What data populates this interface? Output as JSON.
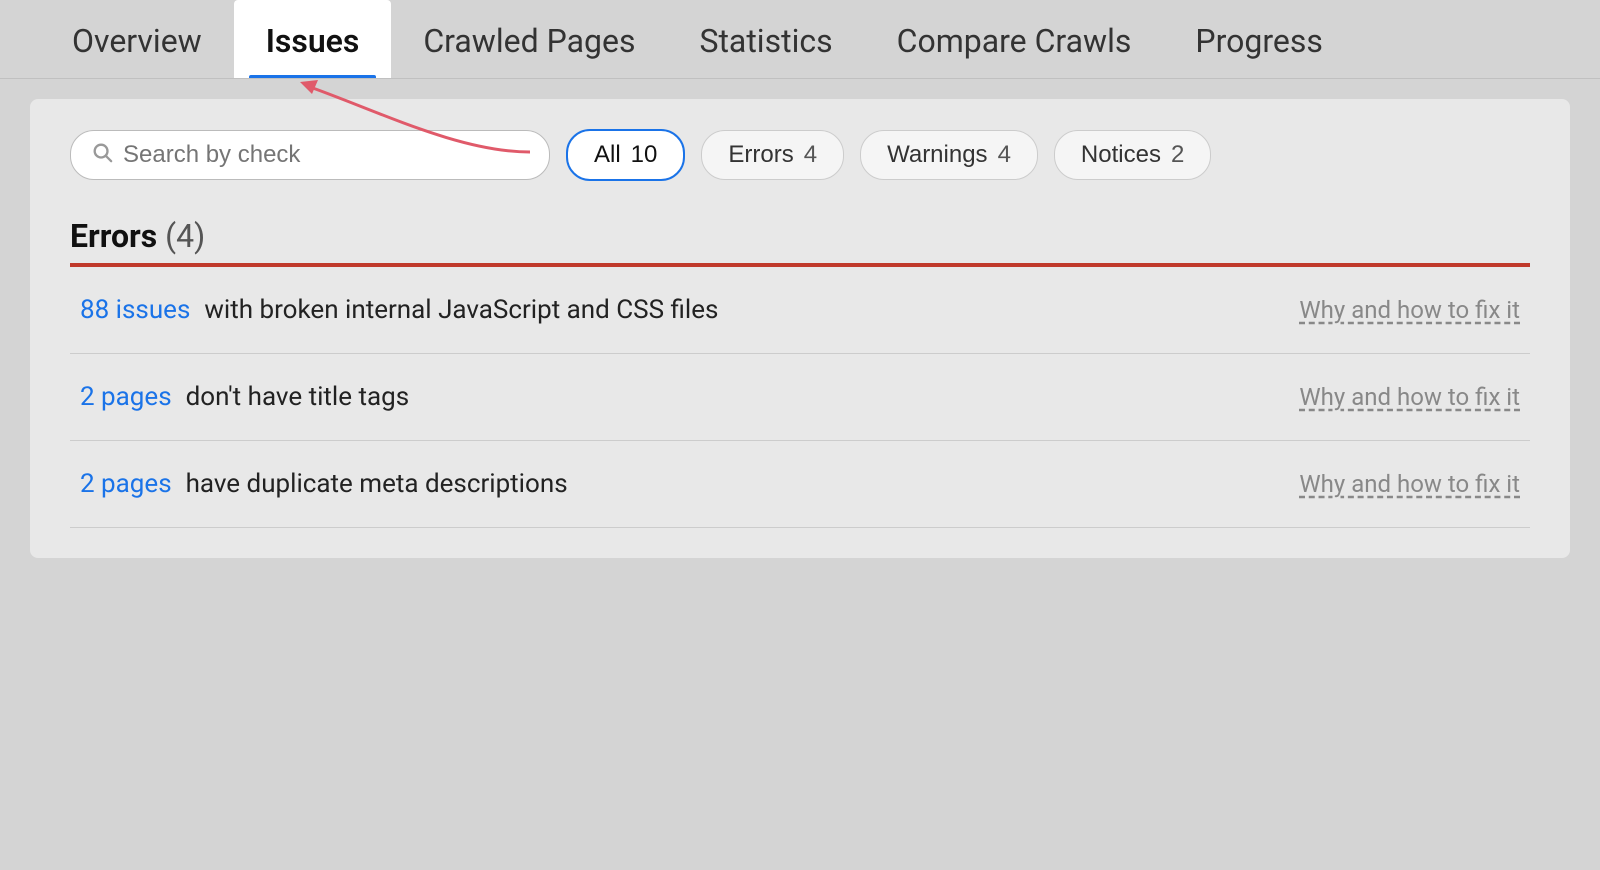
{
  "tabs": [
    {
      "id": "overview",
      "label": "Overview",
      "active": false
    },
    {
      "id": "issues",
      "label": "Issues",
      "active": true
    },
    {
      "id": "crawled-pages",
      "label": "Crawled Pages",
      "active": false
    },
    {
      "id": "statistics",
      "label": "Statistics",
      "active": false
    },
    {
      "id": "compare-crawls",
      "label": "Compare Crawls",
      "active": false
    },
    {
      "id": "progress",
      "label": "Progress",
      "active": false
    }
  ],
  "search": {
    "placeholder": "Search by check"
  },
  "filters": [
    {
      "id": "all",
      "label": "All",
      "count": "10",
      "active": true
    },
    {
      "id": "errors",
      "label": "Errors",
      "count": "4",
      "active": false
    },
    {
      "id": "warnings",
      "label": "Warnings",
      "count": "4",
      "active": false
    },
    {
      "id": "notices",
      "label": "Notices",
      "count": "2",
      "active": false
    }
  ],
  "errors_section": {
    "heading": "Errors",
    "count": "(4)"
  },
  "issues": [
    {
      "link_text": "88 issues",
      "text": " with broken internal JavaScript and CSS files",
      "fix_label": "Why and how to fix it"
    },
    {
      "link_text": "2 pages",
      "text": " don't have title tags",
      "fix_label": "Why and how to fix it"
    },
    {
      "link_text": "2 pages",
      "text": " have duplicate meta descriptions",
      "fix_label": "Why and how to fix it"
    }
  ]
}
